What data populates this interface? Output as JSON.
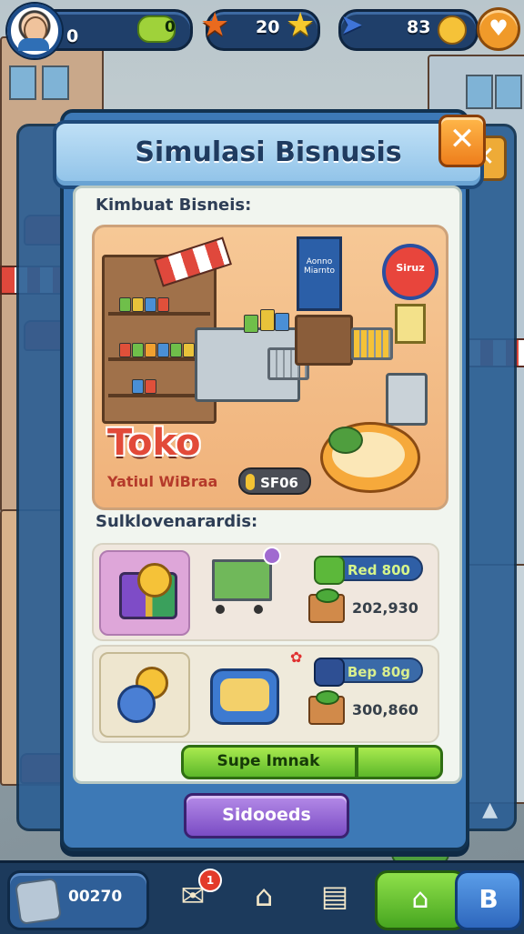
{
  "hud": {
    "player_level": "0",
    "green_currency": "0",
    "star_count": "20",
    "plane_count": "83"
  },
  "modal": {
    "title": "Simulasi Bisnusis",
    "close_symbol": "✕",
    "back_close_symbol": "✕",
    "section1_label": "Kimbuat Bisneis:",
    "scene": {
      "shop_name": "Toko",
      "shop_subtitle": "Yatiul WiBraa",
      "price": "SF06",
      "round_sign": "Siruz",
      "poster_text": "Aonno Miarnto"
    },
    "section2_label": "Sulklovenarardis:",
    "upgrades": [
      {
        "chip_label": "Red 800",
        "amount": "202,930"
      },
      {
        "chip_label": "Bep 80g",
        "amount": "300,860"
      }
    ],
    "green_button_label": "Supe Imnak",
    "purple_button_label": "Sidooeds"
  },
  "nav": {
    "coins": "00270",
    "notification_count": "1",
    "menu_symbol": "B"
  },
  "colors": {
    "modal_blue": "#3d79b6",
    "close_orange": "#ee7e1c",
    "action_green": "#5db82a",
    "action_purple": "#7a4cc4",
    "shop_red": "#e24a39"
  },
  "icons": [
    "avatar",
    "green-gem-icon",
    "star-orange-icon",
    "star-yellow-icon",
    "plane-icon",
    "coin-icon",
    "heart-button-icon",
    "close-icon",
    "leaf-icon",
    "battery-icon",
    "gift-icon",
    "cart-icon",
    "basket-icon",
    "veg-box-icon",
    "card-icon",
    "mail-icon",
    "shop-icon",
    "map-icon",
    "home-icon",
    "menu-icon"
  ]
}
